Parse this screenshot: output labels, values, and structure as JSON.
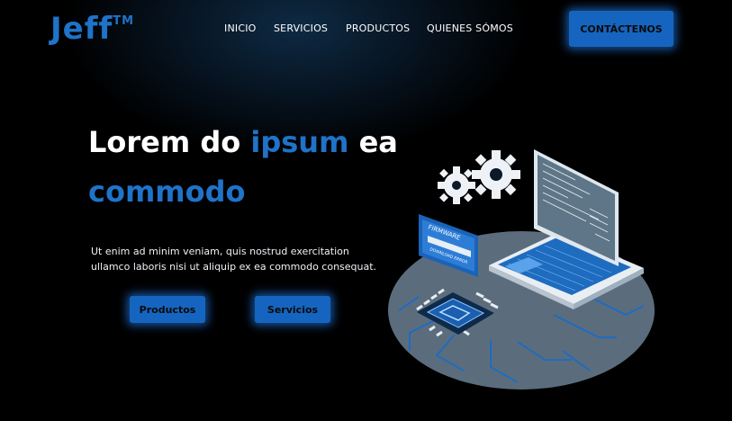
{
  "brand": {
    "name": "Jeff",
    "mark": "TM"
  },
  "nav": [
    "INICIO",
    "SERVICIOS",
    "PRODUCTOS",
    "QUIENES SÓMOS"
  ],
  "contact_label": "CONTÁCTENOS",
  "hero": {
    "title_part1": "Lorem do ",
    "title_accent1": "ipsum",
    "title_part2": " ea",
    "title_accent2": "commodo",
    "description": "Ut enim ad minim veniam, quis nostrud exercitation ullamco laboris nisi ut aliquip ex ea commodo consequat.",
    "btn_products": "Productos",
    "btn_services": "Servicios"
  },
  "illustration": {
    "firmware_label": "FIRMWARE",
    "firmware_sub": "DOWNLOAD ERROR"
  },
  "colors": {
    "accent": "#1f73c9",
    "button": "#1565c0",
    "background": "#000000"
  }
}
